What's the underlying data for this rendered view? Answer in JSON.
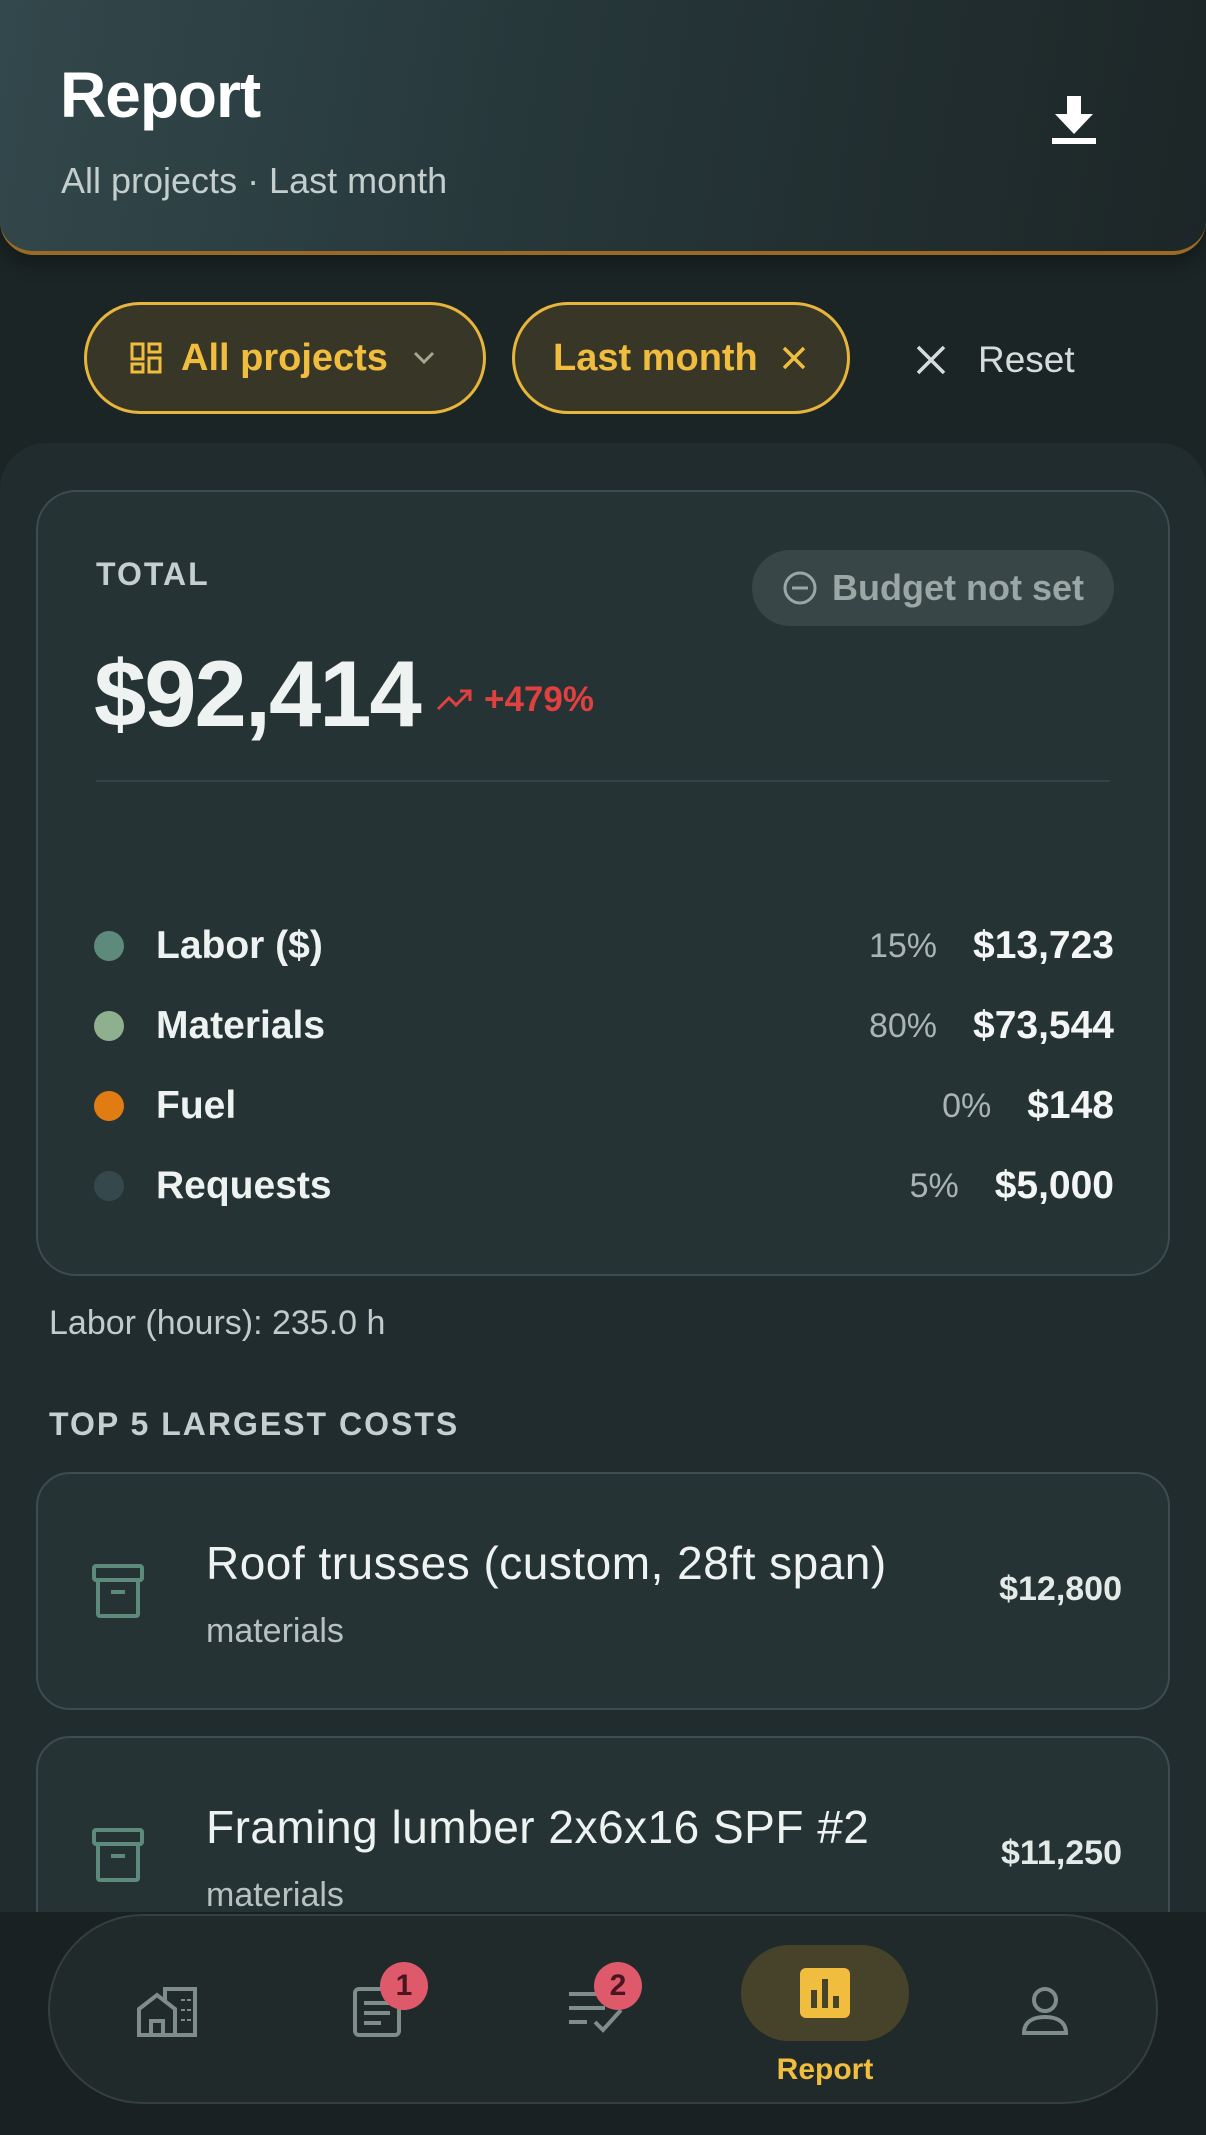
{
  "header": {
    "title": "Report",
    "subtitle": "All projects · Last month",
    "download_icon": "download-icon"
  },
  "filters": {
    "projects_chip": {
      "label": "All projects",
      "icon": "dashboard-icon",
      "trailing_icon": "chevron-down-icon"
    },
    "period_chip": {
      "label": "Last month",
      "trailing_icon": "close-icon"
    },
    "reset": {
      "label": "Reset",
      "icon": "close-icon"
    }
  },
  "total": {
    "label": "TOTAL",
    "amount": "$92,414",
    "trend": "+479%",
    "trend_color": "#e0403f",
    "budget_pill": "Budget not set",
    "categories": [
      {
        "name": "Labor ($)",
        "percent": "15%",
        "amount": "$13,723",
        "color": "#5e8a7c"
      },
      {
        "name": "Materials",
        "percent": "80%",
        "amount": "$73,544",
        "color": "#8fb08f"
      },
      {
        "name": "Fuel",
        "percent": "0%",
        "amount": "$148",
        "color": "#e07c12"
      },
      {
        "name": "Requests",
        "percent": "5%",
        "amount": "$5,000",
        "color": "#35494c"
      }
    ]
  },
  "labor_hours": "Labor (hours): 235.0 h",
  "top_costs": {
    "title": "TOP 5 LARGEST COSTS",
    "items": [
      {
        "name": "Roof trusses (custom, 28ft span)",
        "category": "materials",
        "amount": "$12,800",
        "icon": "archive-box-icon"
      },
      {
        "name": "Framing lumber 2x6x16 SPF #2",
        "category": "materials",
        "amount": "$11,250",
        "icon": "archive-box-icon"
      }
    ]
  },
  "bottom_nav": {
    "items": [
      {
        "id": "projects",
        "icon": "buildings-icon"
      },
      {
        "id": "documents",
        "icon": "document-icon",
        "badge": "1"
      },
      {
        "id": "tasks",
        "icon": "task-list-icon",
        "badge": "2"
      },
      {
        "id": "report",
        "icon": "bar-chart-icon",
        "label": "Report",
        "active": true
      },
      {
        "id": "profile",
        "icon": "person-icon"
      }
    ]
  },
  "colors": {
    "accent": "#f0bd3f",
    "background": "#1b2526",
    "card": "#263335",
    "badge": "#de5a6b"
  }
}
